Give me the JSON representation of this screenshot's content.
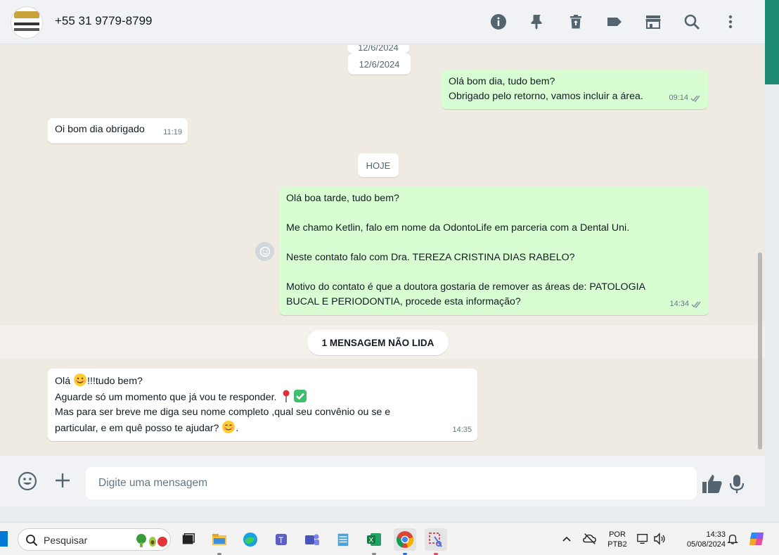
{
  "header": {
    "contact": "+55 31 9779-8799",
    "icons": [
      "info-icon",
      "pin-icon",
      "delete-icon",
      "label-icon",
      "store-icon",
      "search-icon",
      "menu-icon"
    ]
  },
  "chat": {
    "date_top_partial": "12/6/2024",
    "date_top": "12/6/2024",
    "messages": [
      {
        "dir": "out",
        "lines": [
          "Olá bom dia, tudo bem?",
          "Obrigado pelo retorno, vamos incluir a área."
        ],
        "time": "09:14"
      },
      {
        "dir": "in",
        "lines": [
          "Oi bom dia obrigado"
        ],
        "time": "11:19"
      },
      {
        "dir": "out",
        "lines": [
          "Olá boa tarde, tudo bem?",
          "Me chamo Ketlin, falo em nome da OdontoLife em parceria com a Dental Uni.",
          "Neste contato falo com Dra. TEREZA CRISTINA DIAS RABELO?",
          "Motivo do contato é que a doutora gostaria de remover as áreas de:  PATOLOGIA",
          "BUCAL E PERIODONTIA, procede esta informação?"
        ],
        "time": "14:34"
      },
      {
        "dir": "in",
        "lines": [
          "Olá ",
          "!!!tudo bem?",
          "Aguarde só um momento que já vou te responder. ",
          "Mas para ser breve me diga seu nome  completo ,qual seu convênio ou se e",
          "particular, e em quê posso te ajudar? ",
          "."
        ],
        "time": "14:35"
      }
    ],
    "today_label": "HOJE",
    "unread_label": "1 MENSAGEM NÃO LIDA"
  },
  "composer": {
    "placeholder": "Digite uma mensagem"
  },
  "taskbar": {
    "search_label": "Pesquisar",
    "lang_top": "POR",
    "lang_bottom": "PTB2",
    "time": "14:33",
    "date": "05/08/2024"
  },
  "colors": {
    "incoming": "#ffffff",
    "outgoing": "#d9fdd3",
    "chat_bg": "#efeae2",
    "accent": "#1f8a73"
  }
}
